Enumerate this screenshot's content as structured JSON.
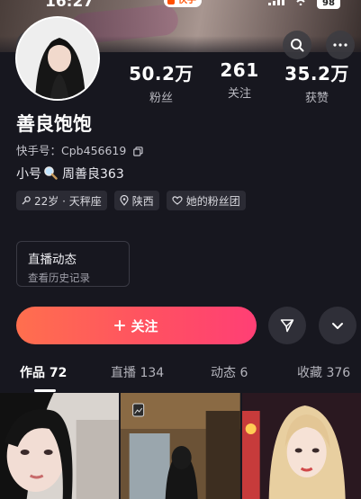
{
  "status_bar": {
    "time": "16:27",
    "app_badge": "快手",
    "battery": "98"
  },
  "profile": {
    "nickname": "善良饱饱",
    "kwai_id_label": "快手号：",
    "kwai_id": "Cpb456619",
    "sub_account_prefix": "小号",
    "sub_account_name": "周善良363"
  },
  "stats": [
    {
      "value": "50.2万",
      "label": "粉丝"
    },
    {
      "value": "261",
      "label": "关注"
    },
    {
      "value": "35.2万",
      "label": "获赞"
    }
  ],
  "tags": [
    {
      "icon": "male-symbol-icon",
      "label": "22岁 · 天秤座"
    },
    {
      "icon": "location-pin-icon",
      "label": "陕西"
    },
    {
      "icon": "heart-outline-icon",
      "label": "她的粉丝团"
    }
  ],
  "live_card": {
    "title": "直播动态",
    "subtitle": "查看历史记录"
  },
  "actions": {
    "follow_label": "关注"
  },
  "tabs": [
    {
      "label": "作品 72",
      "active": true
    },
    {
      "label": "直播 134",
      "active": false
    },
    {
      "label": "动态 6",
      "active": false
    },
    {
      "label": "收藏 376",
      "active": false
    }
  ],
  "colors": {
    "follow_start": "#ff6f4e",
    "follow_end": "#ff3f75",
    "background": "#17171f"
  }
}
